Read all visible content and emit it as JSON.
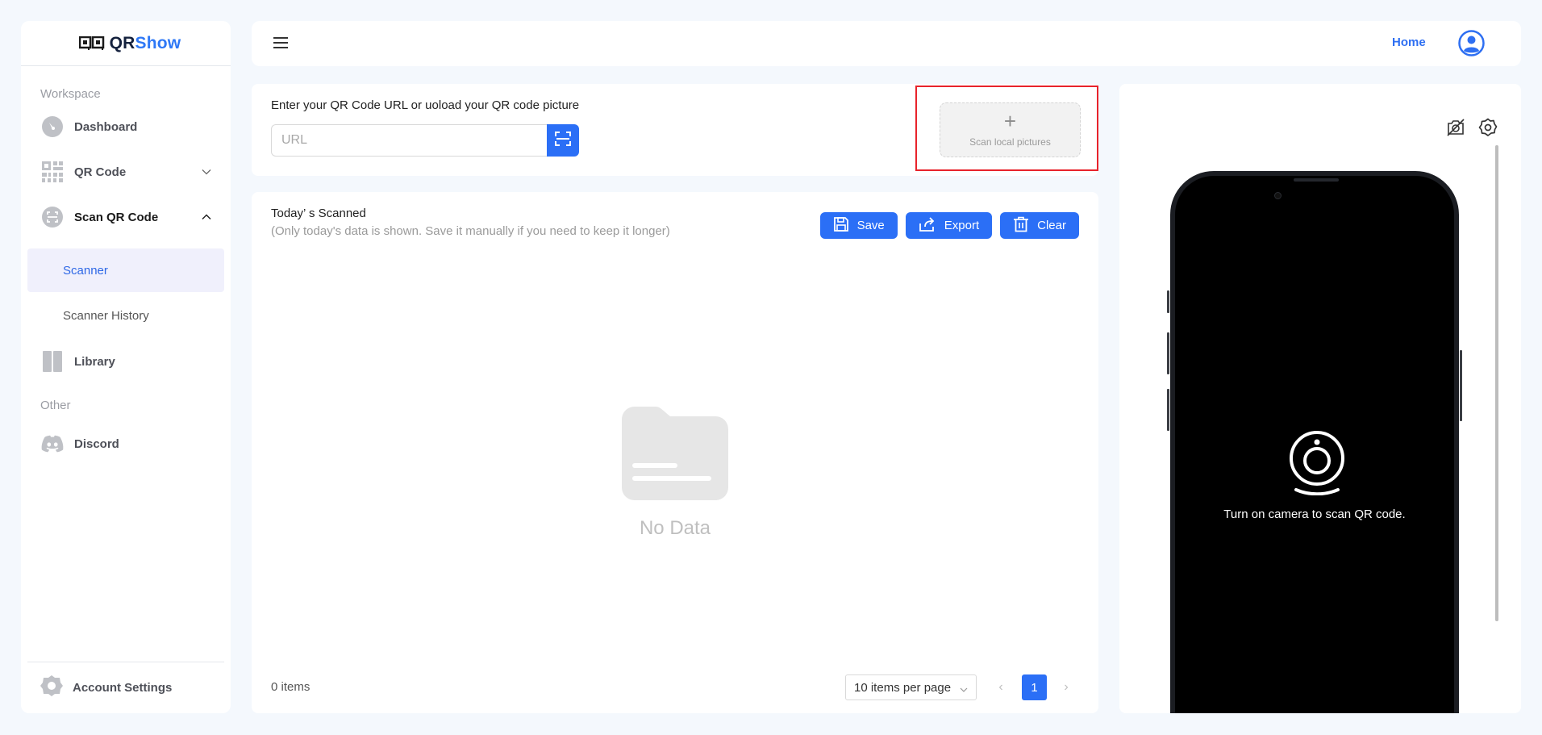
{
  "app": {
    "brand_prefix": "QR",
    "brand_suffix": "Show",
    "accent_color": "#2b6ff6"
  },
  "sidebar": {
    "section_workspace": "Workspace",
    "section_other": "Other",
    "items": [
      {
        "label": "Dashboard",
        "icon": "dashboard-gauge-icon"
      },
      {
        "label": "QR Code",
        "icon": "qr-code-icon",
        "expanded": false
      },
      {
        "label": "Scan QR Code",
        "icon": "scan-icon",
        "expanded": true
      },
      {
        "label": "Library",
        "icon": "library-book-icon"
      },
      {
        "label": "Discord",
        "icon": "discord-icon"
      }
    ],
    "sub_items": [
      {
        "label": "Scanner",
        "active": true
      },
      {
        "label": "Scanner History",
        "active": false
      }
    ],
    "footer_label": "Account Settings"
  },
  "header": {
    "home_label": "Home"
  },
  "url_card": {
    "label": "Enter your QR Code URL or uoload your QR code picture",
    "input_placeholder": "URL",
    "input_value": "",
    "upload_label": "Scan local pictures"
  },
  "today": {
    "title": "Today’ s Scanned",
    "subtitle": "(Only today's data is shown. Save it manually if you need to keep it longer)",
    "buttons": {
      "save": "Save",
      "export": "Export",
      "clear": "Clear"
    },
    "empty_text": "No Data",
    "items_count": "0 items",
    "page_size": "10 items per page",
    "current_page": "1",
    "prev_glyph": "‹",
    "next_glyph": "›"
  },
  "camera": {
    "message": "Turn on camera to scan QR code."
  }
}
